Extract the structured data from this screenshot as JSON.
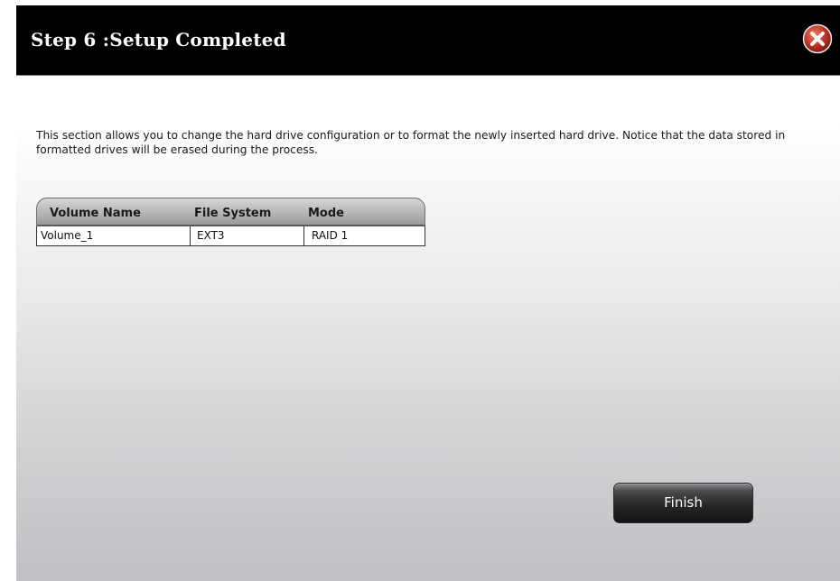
{
  "dialog": {
    "title": "Step 6 :Setup Completed",
    "close_icon": "close-icon",
    "description": "This section allows you to change the hard drive configuration or to format the newly inserted hard drive. Notice that the data stored in formatted drives will be erased during the process.",
    "colors": {
      "titlebar": "#000000",
      "close_button": "#c0392b",
      "finish_button": "#2b2b2b"
    }
  },
  "volume_table": {
    "columns": [
      "Volume Name",
      "File System",
      "Mode"
    ],
    "rows": [
      [
        "Volume_1",
        "EXT3",
        "RAID 1"
      ]
    ]
  },
  "actions": {
    "finish_label": "Finish"
  }
}
